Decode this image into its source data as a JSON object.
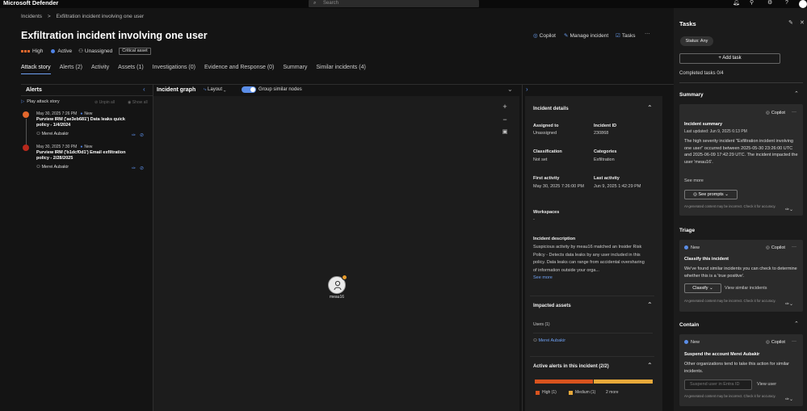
{
  "app": {
    "title": "Microsoft Defender"
  },
  "search": {
    "placeholder": "Search"
  },
  "breadcrumb": {
    "root": "Incidents",
    "sep": ">",
    "current": "Exfiltration incident involving one user"
  },
  "incident": {
    "title": "Exfiltration incident involving one user",
    "severity": "High",
    "status": "Active",
    "assignee": "Unassigned",
    "tag": "Critical asset"
  },
  "header_actions": {
    "copilot": "Copilot",
    "manage": "Manage incident",
    "tasks": "Tasks",
    "more": "···"
  },
  "tabs": [
    {
      "label": "Attack story"
    },
    {
      "label": "Alerts (2)"
    },
    {
      "label": "Activity"
    },
    {
      "label": "Assets (1)"
    },
    {
      "label": "Investigations (0)"
    },
    {
      "label": "Evidence and Response (0)"
    },
    {
      "label": "Summary"
    },
    {
      "label": "Similar incidents (4)"
    }
  ],
  "alerts_panel": {
    "title": "Alerts",
    "play": "Play attack story",
    "unpin": "Unpin all",
    "show": "Show all",
    "items": [
      {
        "date": "May 30, 2025 7:26 PM",
        "status": "New",
        "name": "Purview IRM ('ae3eb681') Data leaks quick policy - 1/4/2024",
        "user": "Merei Aubakir",
        "color": "#e3672c"
      },
      {
        "date": "May 30, 2025 7:30 PM",
        "status": "New",
        "name": "Purview IRM ('b1dcf0d1') Email exfiltration policy - 2/28/2025",
        "user": "Merei Aubakir",
        "color": "#b8281c"
      }
    ]
  },
  "graph": {
    "title": "Incident graph",
    "layout": "Layout",
    "group": "Group similar nodes",
    "node_label": "meau16"
  },
  "details": {
    "title": "Incident details",
    "assigned_to_label": "Assigned to",
    "assigned_to": "Unassigned",
    "incident_id_label": "Incident ID",
    "incident_id": "230868",
    "classification_label": "Classification",
    "classification": "Not set",
    "categories_label": "Categories",
    "categories": "Exfiltration",
    "first_activity_label": "First activity",
    "first_activity": "May 30, 2025 7:26:00 PM",
    "last_activity_label": "Last activity",
    "last_activity": "Jun 9, 2025 1:42:29 PM",
    "workspaces_label": "Workspaces",
    "workspaces": "-",
    "description_label": "Incident description",
    "description": "Suspicious activity by meau16 matched an Insider Risk Policy - Detects data leaks by any user included in this policy. Data leaks can range from accidental oversharing of information outside your orga...",
    "see_more": "See more",
    "impacted_title": "Impacted assets",
    "users_label": "Users (1)",
    "user": "Merei Aubakir",
    "active_alerts_title": "Active alerts in this incident (2/2)",
    "legend": {
      "high": "High (1)",
      "medium": "Medium (1)",
      "more": "2 more"
    },
    "alert_mix": {
      "high": 1,
      "medium": 1
    },
    "colors": {
      "high": "#d9531e",
      "medium": "#e8a93a"
    }
  },
  "tasks": {
    "title": "Tasks",
    "status": "Status: Any",
    "add": "+ Add task",
    "completed": "Completed tasks 0/4",
    "summary": {
      "title": "Summary",
      "copilot": "Copilot",
      "card_title": "Incident summary",
      "updated": "Last updated: Jun 9, 2025 6:13 PM",
      "body": "The high severity incident \"Exfiltration incident involving one user\" occurred between 2025-05-30 23:26:00 UTC and 2025-06-09 17:42:29 UTC. The incident impacted the user 'meau16'.",
      "see_more": "See more",
      "see_prompts": "See prompts",
      "disclaimer": "AI-generated content may be incorrect. Check it for accuracy."
    },
    "triage": {
      "title": "Triage",
      "status": "New",
      "copilot": "Copilot",
      "card_title": "Classify this incident",
      "body": "We've found similar incidents you can check to determine whether this is a 'true positive'.",
      "classify": "Classify",
      "view_similar": "View similar incidents",
      "disclaimer": "AI-generated content may be incorrect. Check it for accuracy."
    },
    "contain": {
      "title": "Contain",
      "status": "New",
      "copilot": "Copilot",
      "card_title": "Suspend the account Merei Aubakir",
      "body": "Other organizations tend to take this action for similar incidents.",
      "input_placeholder": "Suspend user in Entra ID",
      "view_user": "View user",
      "disclaimer": "AI-generated content may be incorrect. Check it for accuracy."
    }
  }
}
